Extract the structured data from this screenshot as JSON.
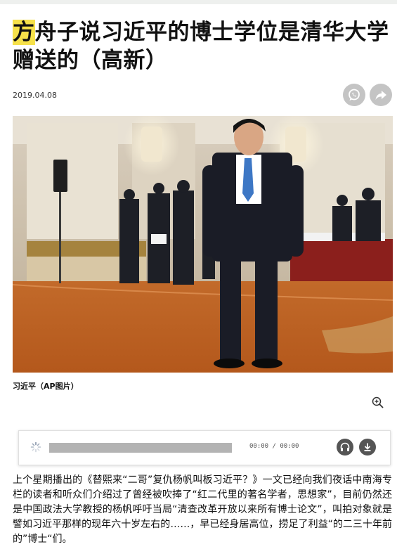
{
  "article": {
    "title_highlight": "方",
    "title_rest": "舟子说习近平的博士学位是清华大学赠送的（高新）",
    "date": "2019.04.08",
    "photo_caption": "习近平（AP图片）",
    "body": "上个星期播出的《替熙来“二哥”复仇杨帆叫板习近平？》一文已经向我们夜话中南海专栏的读者和听众们介绍过了曾经被吹捧了“红二代里的著名学者，思想家”，目前仍然还是中国政法大学教授的杨帆呼吁当局“清查改革开放以来所有博士论文”，叫拍对象就是譬如习近平那样的现年六十岁左右的……，早已经身居高位，捞足了利益“的二三十年前的”博士“们。"
  },
  "share": {
    "whatsapp_icon": "whatsapp-icon",
    "forward_icon": "share-arrow-icon"
  },
  "audio_player": {
    "time_display": "00:00 / 00:00",
    "progress": 0,
    "headphones_icon": "headphones-icon",
    "download_icon": "download-icon"
  },
  "colors": {
    "highlight": "#f6e14a",
    "icon_gray": "#c4c4c4",
    "player_button": "#555555"
  }
}
